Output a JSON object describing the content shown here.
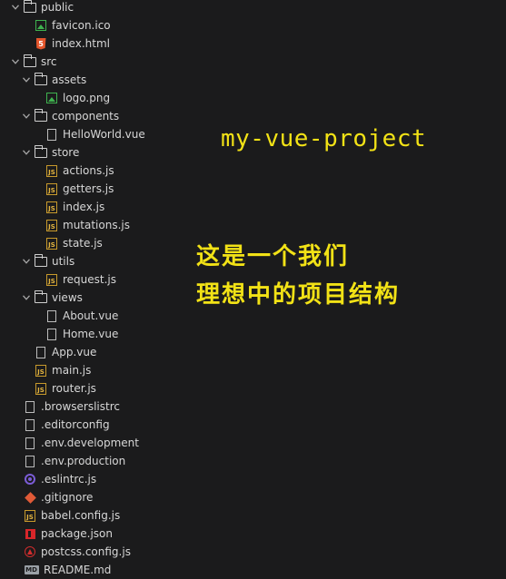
{
  "tree": [
    {
      "label": "public",
      "icon": "folder-open-icon",
      "expanded": true,
      "depth": 0
    },
    {
      "label": "favicon.ico",
      "icon": "image-file-icon",
      "depth": 1
    },
    {
      "label": "index.html",
      "icon": "html5-file-icon",
      "depth": 1
    },
    {
      "label": "src",
      "icon": "folder-open-icon",
      "expanded": true,
      "depth": 0
    },
    {
      "label": "assets",
      "icon": "folder-open-icon",
      "expanded": true,
      "depth": 1
    },
    {
      "label": "logo.png",
      "icon": "image-file-icon",
      "depth": 2
    },
    {
      "label": "components",
      "icon": "folder-open-icon",
      "expanded": true,
      "depth": 1
    },
    {
      "label": "HelloWorld.vue",
      "icon": "file-icon",
      "depth": 2
    },
    {
      "label": "store",
      "icon": "folder-open-icon",
      "expanded": true,
      "depth": 1
    },
    {
      "label": "actions.js",
      "icon": "js-file-icon",
      "depth": 2
    },
    {
      "label": "getters.js",
      "icon": "js-file-icon",
      "depth": 2
    },
    {
      "label": "index.js",
      "icon": "js-file-icon",
      "depth": 2
    },
    {
      "label": "mutations.js",
      "icon": "js-file-icon",
      "depth": 2
    },
    {
      "label": "state.js",
      "icon": "js-file-icon",
      "depth": 2
    },
    {
      "label": "utils",
      "icon": "folder-open-icon",
      "expanded": true,
      "depth": 1
    },
    {
      "label": "request.js",
      "icon": "js-file-icon",
      "depth": 2
    },
    {
      "label": "views",
      "icon": "folder-open-icon",
      "expanded": true,
      "depth": 1
    },
    {
      "label": "About.vue",
      "icon": "file-icon",
      "depth": 2
    },
    {
      "label": "Home.vue",
      "icon": "file-icon",
      "depth": 2
    },
    {
      "label": "App.vue",
      "icon": "file-icon",
      "depth": 1
    },
    {
      "label": "main.js",
      "icon": "js-file-icon",
      "depth": 1
    },
    {
      "label": "router.js",
      "icon": "js-file-icon",
      "depth": 1
    },
    {
      "label": ".browserslistrc",
      "icon": "file-icon",
      "depth": 0
    },
    {
      "label": ".editorconfig",
      "icon": "file-icon",
      "depth": 0
    },
    {
      "label": ".env.development",
      "icon": "file-icon",
      "depth": 0
    },
    {
      "label": ".env.production",
      "icon": "file-icon",
      "depth": 0
    },
    {
      "label": ".eslintrc.js",
      "icon": "eslint-icon",
      "depth": 0
    },
    {
      "label": ".gitignore",
      "icon": "git-icon",
      "depth": 0
    },
    {
      "label": "babel.config.js",
      "icon": "js-file-icon",
      "depth": 0
    },
    {
      "label": "package.json",
      "icon": "npm-package-icon",
      "depth": 0
    },
    {
      "label": "postcss.config.js",
      "icon": "postcss-icon",
      "depth": 0
    },
    {
      "label": "README.md",
      "icon": "markdown-icon",
      "depth": 0
    }
  ],
  "annotation": {
    "title": "my-vue-project",
    "line1": "这是一个我们",
    "line2": "理想中的项目结构"
  },
  "colors": {
    "background": "#1b1b1c",
    "annotation": "#f2e216"
  }
}
